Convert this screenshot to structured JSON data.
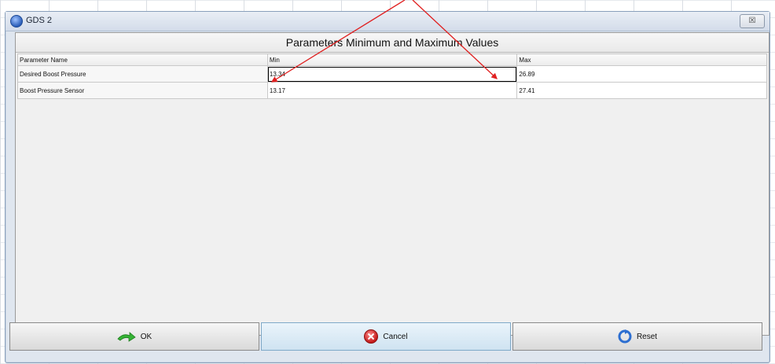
{
  "window": {
    "title": "GDS 2",
    "close_label": "☒"
  },
  "panel": {
    "title": "Parameters Minimum and Maximum Values"
  },
  "table": {
    "columns": [
      "Parameter Name",
      "Min",
      "Max"
    ],
    "rows": [
      {
        "name": "Desired Boost Pressure",
        "min": "13.34",
        "max": "26.89"
      },
      {
        "name": "Boost Pressure Sensor",
        "min": "13.17",
        "max": "27.41"
      }
    ]
  },
  "buttons": {
    "ok": "OK",
    "cancel": "Cancel",
    "reset": "Reset"
  },
  "icons": {
    "app": "gds-app-icon",
    "ok": "green-arrow-icon",
    "cancel": "red-x-icon",
    "reset": "blue-refresh-icon",
    "close": "close-icon"
  },
  "colors": {
    "annotation": "#e02020",
    "cancel_highlight": "#cfe3f1"
  }
}
